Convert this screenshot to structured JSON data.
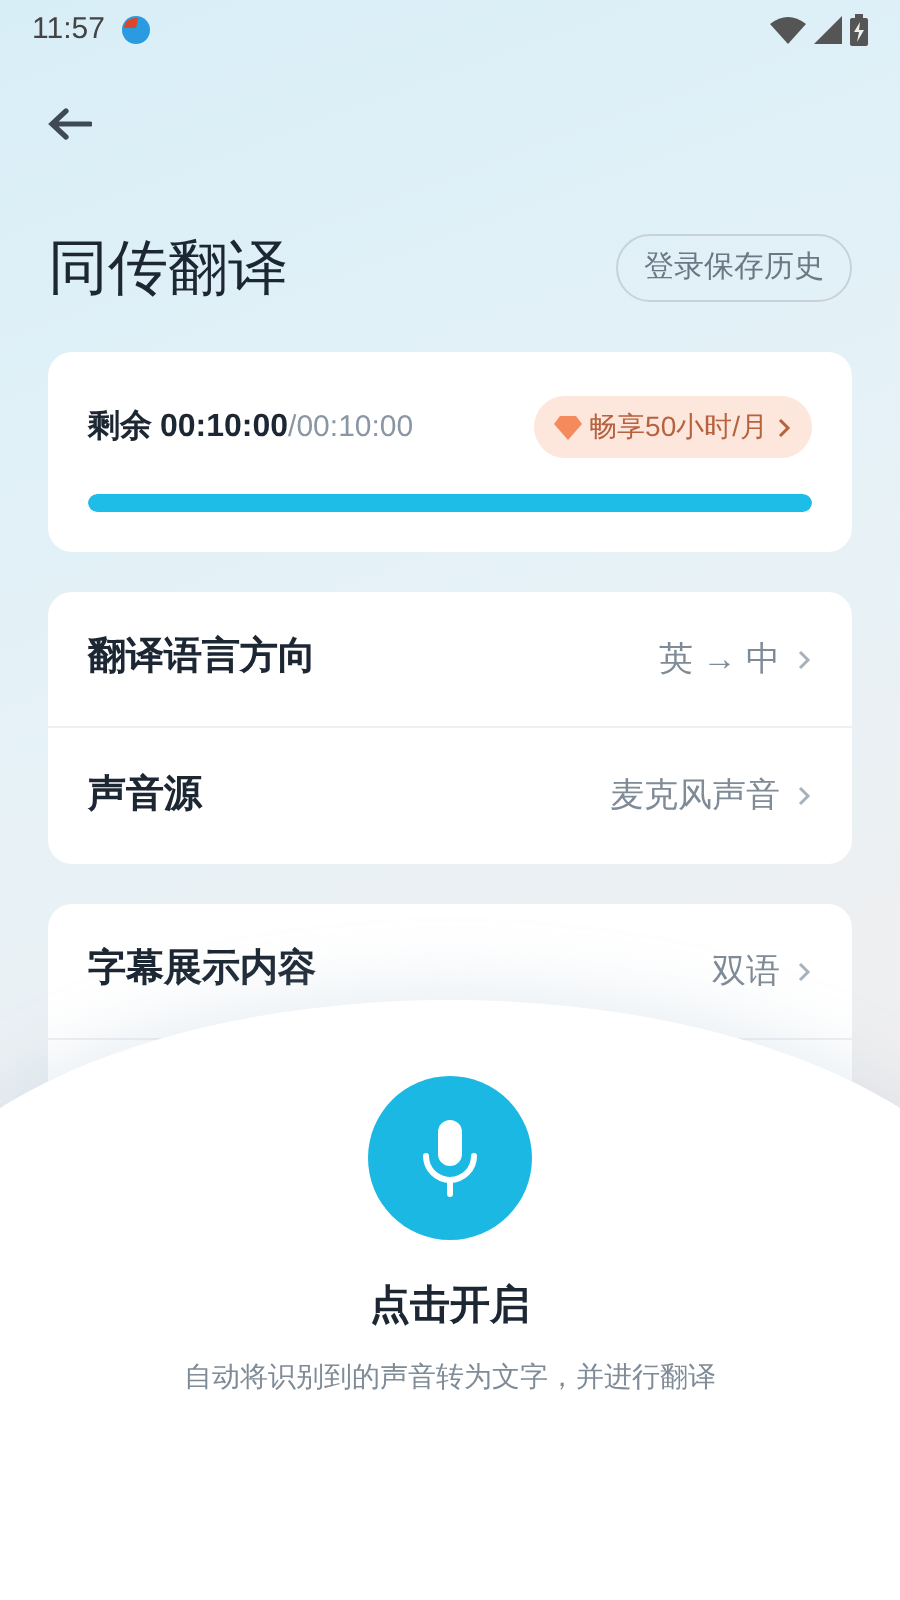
{
  "status_bar": {
    "time": "11:57"
  },
  "header": {
    "title": "同传翻译",
    "login_button": "登录保存历史"
  },
  "quota": {
    "label": "剩余",
    "remaining": "00:10:00",
    "total": "/00:10:00",
    "upgrade": "畅享50小时/月",
    "level": 1.0
  },
  "settings_groups": [
    {
      "rows": [
        {
          "label": "翻译语言方向",
          "value": "英 → 中"
        },
        {
          "label": "声音源",
          "value": "麦克风声音"
        }
      ]
    },
    {
      "rows": [
        {
          "label": "字幕展示内容",
          "value": "双语"
        }
      ]
    }
  ],
  "start": {
    "title": "点击开启",
    "description": "自动将识别到的声音转为文字，并进行翻译"
  }
}
